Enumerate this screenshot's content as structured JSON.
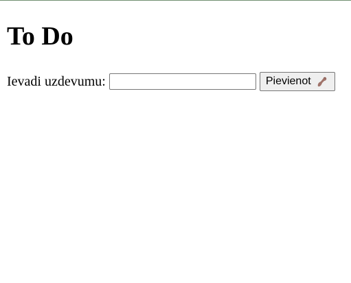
{
  "page": {
    "title": "To Do"
  },
  "form": {
    "label": "Ievadi uzdevumu:",
    "input_value": "",
    "input_placeholder": "",
    "button_label": "Pievienot",
    "button_icon": "pinching-hand-icon"
  },
  "colors": {
    "icon": "#a0736a"
  }
}
